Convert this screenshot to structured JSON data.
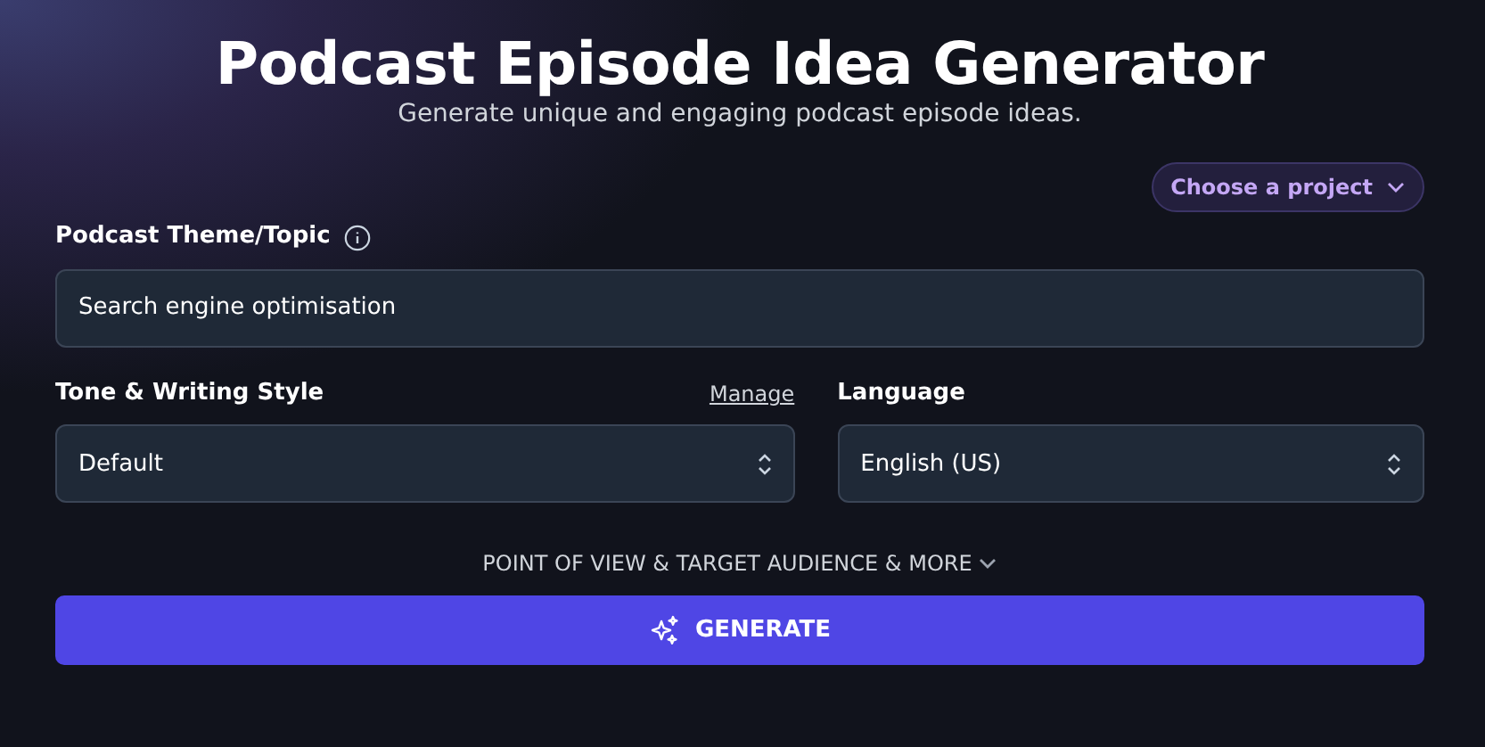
{
  "header": {
    "title": "Podcast Episode Idea Generator",
    "subtitle": "Generate unique and engaging podcast episode ideas."
  },
  "project_picker": {
    "label": "Choose a project"
  },
  "theme_field": {
    "label": "Podcast Theme/Topic",
    "value": "Search engine optimisation"
  },
  "tone_select": {
    "label": "Tone & Writing Style",
    "link": "Manage",
    "value": "Default"
  },
  "language_select": {
    "label": "Language",
    "value": "English (US)"
  },
  "more_toggle": {
    "label": "POINT OF VIEW & TARGET AUDIENCE & MORE",
    "expanded": false
  },
  "generate_button": {
    "label": "GENERATE"
  }
}
